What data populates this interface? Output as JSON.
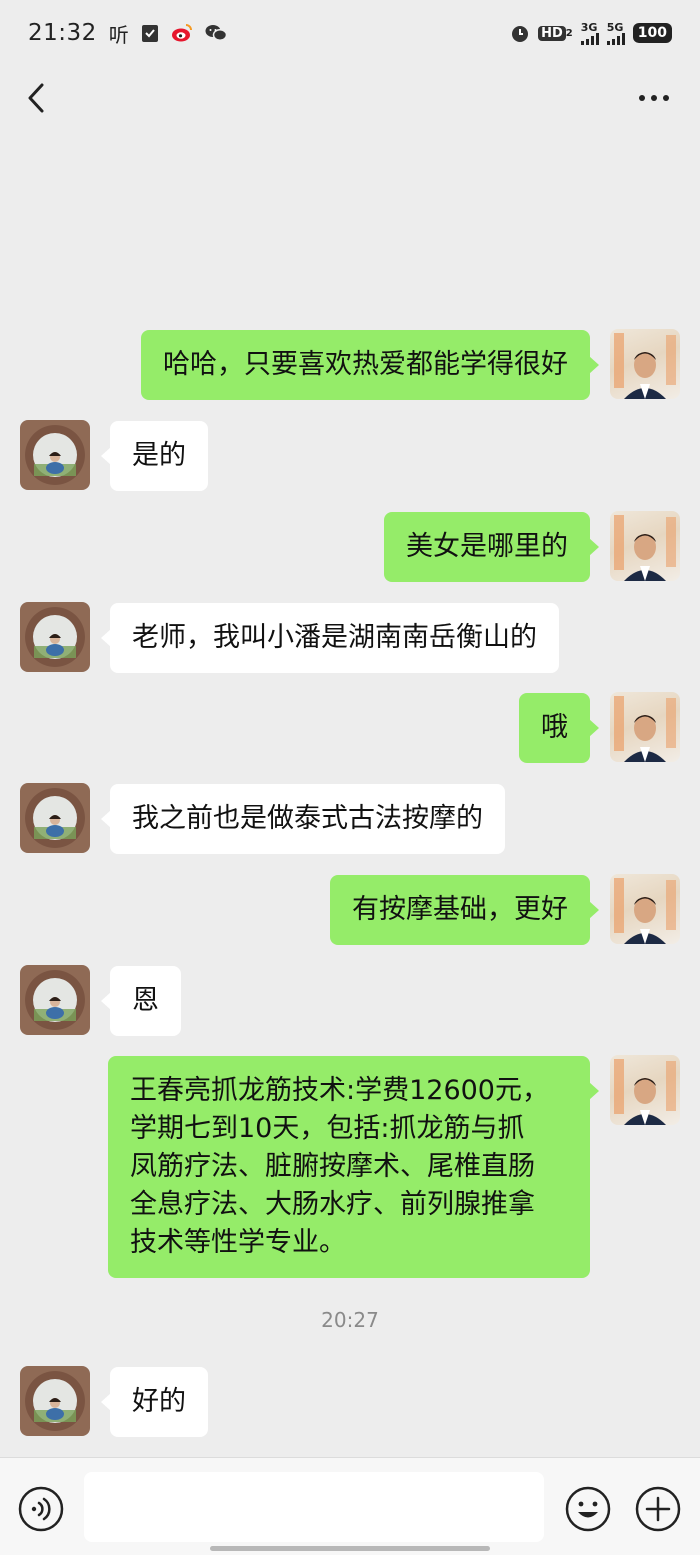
{
  "status_bar": {
    "time": "21:32",
    "left_icons": [
      "listen-icon",
      "check-icon",
      "weibo-icon",
      "wechat-icon"
    ],
    "listen_label": "听",
    "hd_label": "HD",
    "hd_sub": "2",
    "net1": "3G",
    "net2": "5G",
    "battery": "100"
  },
  "title_bar": {
    "title": ""
  },
  "messages": [
    {
      "side": "right",
      "text": "哈哈，只要喜欢热爱都能学得很好"
    },
    {
      "side": "left",
      "text": "是的"
    },
    {
      "side": "right",
      "text": "美女是哪里的"
    },
    {
      "side": "left",
      "text": "老师，我叫小潘是湖南南岳衡山的"
    },
    {
      "side": "right",
      "text": "哦"
    },
    {
      "side": "left",
      "text": "我之前也是做泰式古法按摩的"
    },
    {
      "side": "right",
      "text": "有按摩基础，更好"
    },
    {
      "side": "left",
      "text": "恩"
    },
    {
      "side": "right",
      "text": "王春亮抓龙筋技术:学费12600元，\n学期七到10天，包括:抓龙筋与抓\n凤筋疗法、脏腑按摩术、尾椎直肠\n全息疗法、大肠水疗、前列腺推拿\n技术等性学专业。"
    },
    {
      "side": "left",
      "text": "好的"
    }
  ],
  "timestamp": "20:27",
  "input_bar": {
    "value": "",
    "placeholder": ""
  },
  "colors": {
    "background": "#ededed",
    "bubble_self": "#95ec69",
    "bubble_other": "#ffffff",
    "timestamp": "#8a8a8a"
  }
}
